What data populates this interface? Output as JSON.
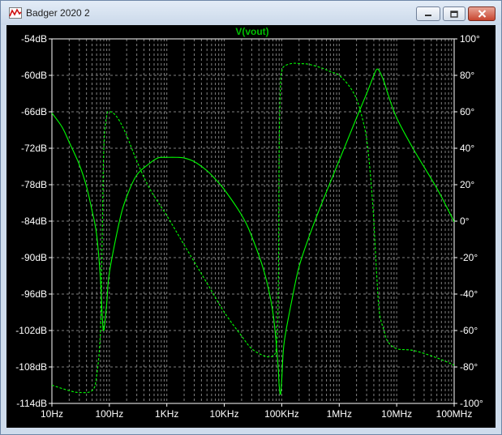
{
  "window": {
    "title": "Badger 2020 2",
    "icon": "waveform-plot-icon",
    "controls": [
      "minimize-icon",
      "maximize-icon",
      "close-icon"
    ]
  },
  "colors": {
    "background": "#000000",
    "grid": "#808080",
    "trace": "#00ff00",
    "trace_label": "#00c000",
    "axis_text": "#ffffff"
  },
  "chart_data": {
    "type": "line",
    "title": "V(vout)",
    "xscale": "log",
    "xlim": [
      10,
      100000000
    ],
    "xticks": [
      10,
      100,
      1000,
      10000,
      100000,
      1000000,
      10000000,
      100000000
    ],
    "xtick_labels": [
      "10Hz",
      "100Hz",
      "1KHz",
      "10KHz",
      "100KHz",
      "1MHz",
      "10MHz",
      "100MHz"
    ],
    "ylim": [
      -114,
      -54
    ],
    "yticks": [
      -54,
      -60,
      -66,
      -72,
      -78,
      -84,
      -90,
      -96,
      -102,
      -108,
      -114
    ],
    "ytick_labels": [
      "-54dB",
      "-60dB",
      "-66dB",
      "-72dB",
      "-78dB",
      "-84dB",
      "-90dB",
      "-96dB",
      "-102dB",
      "-108dB",
      "-114dB"
    ],
    "y2lim": [
      -100,
      100
    ],
    "y2ticks": [
      100,
      80,
      60,
      40,
      20,
      0,
      -20,
      -40,
      -60,
      -80,
      -100
    ],
    "y2tick_labels": [
      "100°",
      "80°",
      "60°",
      "40°",
      "20°",
      "0°",
      "-20°",
      "-40°",
      "-60°",
      "-80°",
      "-100°"
    ],
    "grid": true,
    "series": [
      {
        "name": "V(vout)",
        "style": "solid",
        "axis": "left",
        "x": [
          10,
          15,
          20,
          30,
          40,
          50,
          60,
          70,
          75,
          80,
          90,
          100,
          150,
          200,
          300,
          500,
          700,
          1000,
          1500,
          2000,
          3000,
          5000,
          7000,
          10000,
          20000,
          30000,
          50000,
          70000,
          85000,
          90000,
          95000,
          100000,
          110000,
          150000,
          200000,
          300000,
          500000,
          1000000,
          2000000,
          3000000,
          4000000,
          4500000,
          5000000,
          6000000,
          7000000,
          10000000,
          20000000,
          50000000,
          100000000
        ],
        "y": [
          -66.2,
          -68.5,
          -71,
          -74.7,
          -78.3,
          -82.3,
          -86.2,
          -93.5,
          -99.5,
          -102,
          -97.5,
          -92.5,
          -84,
          -80,
          -76.4,
          -74.5,
          -73.6,
          -73.5,
          -73.5,
          -73.6,
          -74.2,
          -75.7,
          -77.1,
          -78.8,
          -83,
          -86.5,
          -92.5,
          -99,
          -107,
          -111,
          -112.5,
          -110,
          -104,
          -97,
          -91.5,
          -86.5,
          -81,
          -74,
          -67,
          -63,
          -60,
          -59,
          -59.3,
          -61,
          -63,
          -67,
          -72.3,
          -78.6,
          -84.1
        ]
      },
      {
        "name": "phase",
        "style": "dashed",
        "axis": "right",
        "x": [
          10,
          20,
          30,
          50,
          60,
          70,
          75,
          80,
          90,
          100,
          120,
          150,
          200,
          300,
          500,
          1000,
          2000,
          5000,
          10000,
          20000,
          30000,
          50000,
          70000,
          80000,
          85000,
          88000,
          90000,
          95000,
          100000,
          110000,
          150000,
          200000,
          300000,
          500000,
          700000,
          1000000,
          1500000,
          2000000,
          2500000,
          3000000,
          3500000,
          4000000,
          4500000,
          5000000,
          6000000,
          7000000,
          10000000,
          20000000,
          50000000,
          100000000
        ],
        "y": [
          -90,
          -93,
          -94,
          -93,
          -85,
          -60,
          -10,
          40,
          58,
          60,
          59,
          55,
          47,
          33,
          18,
          3,
          -13,
          -34,
          -50,
          -63,
          -70,
          -74,
          -74,
          -70,
          -55,
          -20,
          40,
          75,
          82,
          85,
          86.5,
          86.5,
          86,
          84,
          82,
          80,
          74,
          67,
          57,
          45,
          25,
          0,
          -30,
          -50,
          -60,
          -66,
          -70,
          -71,
          -75,
          -79
        ]
      }
    ]
  }
}
